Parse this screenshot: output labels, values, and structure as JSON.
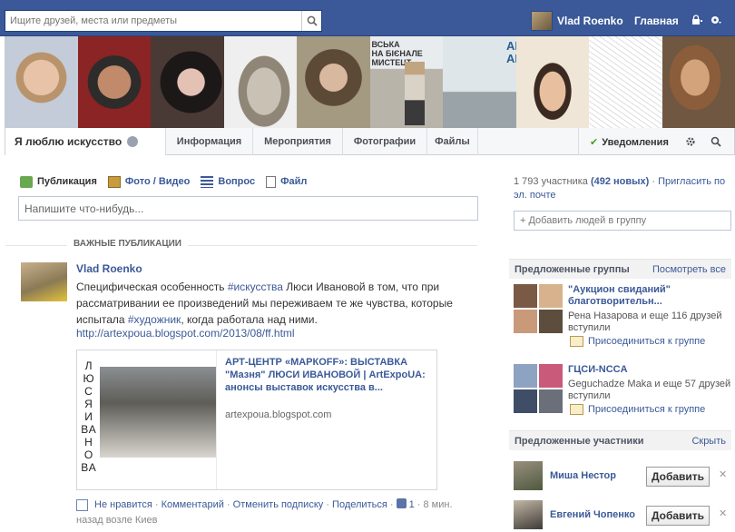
{
  "search": {
    "placeholder": "Ищите друзей, места или предметы"
  },
  "topnav": {
    "user_name": "Vlad Roenko",
    "home_label": "Главная"
  },
  "group": {
    "title": "Я люблю искусство",
    "tabs": [
      "Информация",
      "Мероприятия",
      "Фотографии",
      "Файлы"
    ],
    "notifications_label": "Уведомления"
  },
  "cover": {
    "sign_text": "ВСЬКА\nНА БІЄНАЛЕ\nМИСТЕЦТ",
    "sign_text2": "АР\nAR"
  },
  "composer": {
    "tabs": [
      "Публикация",
      "Фото / Видео",
      "Вопрос",
      "Файл"
    ],
    "placeholder": "Напишите что-нибудь..."
  },
  "feed": {
    "section_label": "ВАЖНЫЕ ПУБЛИКАЦИИ",
    "post": {
      "author": "Vlad Roenko",
      "text_parts": [
        "Специфическая особенность ",
        "#искусства",
        " Люси Ивановой в том, что при рассматривании ее произведений мы переживаем те же чувства, которые испытала ",
        "#художник",
        ", когда работала над ними."
      ],
      "link": "http://artexpoua.blogspot.com/2013/08/ff.html",
      "share": {
        "title": "АРТ-ЦЕНТР «МАРКОFF»: ВЫСТАВКА \"Мазня\" ЛЮСИ ИВАНОВОЙ | ArtExpoUA: анонсы выставок искусства в...",
        "domain": "artexpoua.blogspot.com",
        "image_text": "ЛЮСЯИВАНОВА"
      },
      "actions": {
        "unlike": "Не нравится",
        "comment": "Комментарий",
        "unfollow": "Отменить подписку",
        "share": "Поделиться",
        "likes": "1",
        "time": "8 мин. назад возле Киев"
      }
    }
  },
  "sidebar": {
    "members_count": "1 793 участника",
    "new_count": "(492 новых)",
    "invite": "Пригласить по эл. почте",
    "add_people": "+ Добавить людей в группу",
    "suggested_groups_label": "Предложенные группы",
    "see_all": "Посмотреть все",
    "groups": [
      {
        "name": "\"Аукцион свиданий\" благотворительн...",
        "desc": "Рена Назарова и еще 116 друзей вступили",
        "join": "Присоединиться к группе"
      },
      {
        "name": "ГЦСИ-NCCA",
        "desc": "Geguchadze Maka и еще 57 друзей вступили",
        "join": "Присоединиться к группе"
      }
    ],
    "suggested_members_label": "Предложенные участники",
    "hide": "Скрыть",
    "members": [
      {
        "name": "Миша Нестор",
        "button": "Добавить"
      },
      {
        "name": "Евгений Чопенко",
        "button": "Добавить"
      }
    ]
  },
  "colors": {
    "brand": "#3b5998",
    "check": "#4a9b28"
  }
}
